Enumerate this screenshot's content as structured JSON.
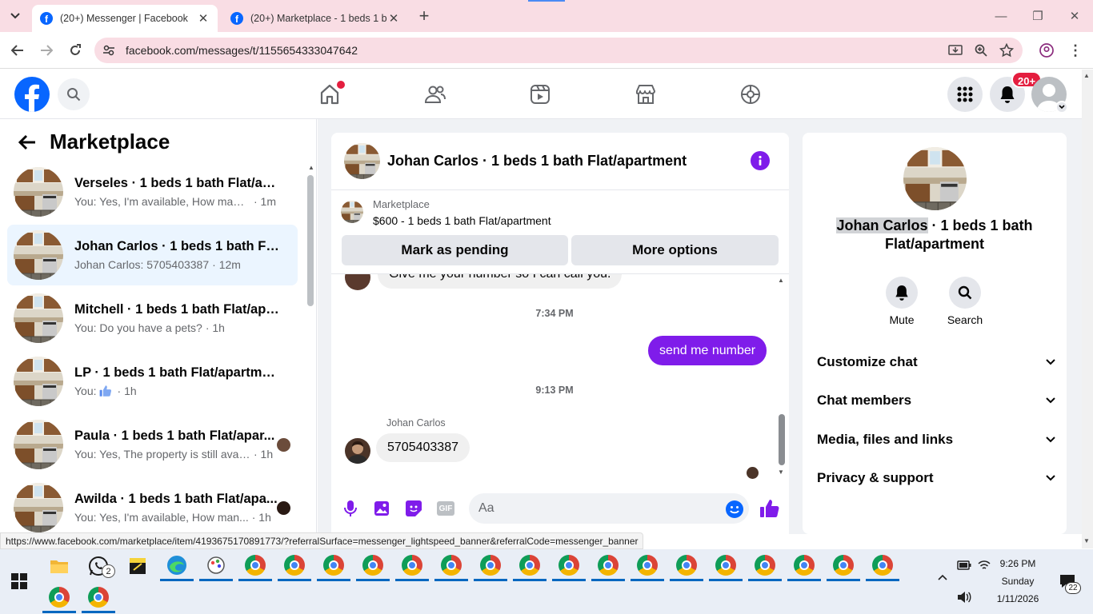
{
  "browser": {
    "tabs": [
      {
        "title": "(20+) Messenger | Facebook",
        "active": true
      },
      {
        "title": "(20+) Marketplace - 1 beds 1 b...",
        "active": false
      }
    ],
    "url": "facebook.com/messages/t/1155654333047642",
    "status_url": "https://www.facebook.com/marketplace/item/4193675170891773/?referralSurface=messenger_lightspeed_banner&referralCode=messenger_banner"
  },
  "fb": {
    "notif_badge": "20+"
  },
  "sidebar": {
    "title": "Marketplace",
    "conversations": [
      {
        "name": "Verseles · 1 beds 1 bath Flat/apar...",
        "preview": "You: Yes, I'm available, How many ...",
        "time": "· 1m",
        "selected": false
      },
      {
        "name": "Johan Carlos · 1 beds 1 bath Flat/...",
        "preview": "Johan Carlos: 5705403387",
        "time": "· 12m",
        "selected": true
      },
      {
        "name": "Mitchell · 1 beds 1 bath Flat/apar...",
        "preview": "You: Do you have a pets?",
        "time": "· 1h",
        "selected": false
      },
      {
        "name": "LP · 1 beds 1 bath Flat/apartment",
        "preview": "You:",
        "time": "· 1h",
        "selected": false
      },
      {
        "name": "Paula · 1 beds 1 bath Flat/apar...",
        "preview": "You: Yes, The property is still avai...",
        "time": "· 1h",
        "selected": false
      },
      {
        "name": "Awilda · 1 beds 1 bath Flat/apa...",
        "preview": "You: Yes, I'm available, How man...",
        "time": "· 1h",
        "selected": false
      }
    ]
  },
  "chat": {
    "header_title": "Johan Carlos · 1 beds 1 bath Flat/apartment",
    "listing_source": "Marketplace",
    "listing_title": "$600 - 1 beds 1 bath Flat/apartment",
    "mark_pending": "Mark as pending",
    "more_options": "More options",
    "partial_message": "Give me your number so I can call you.",
    "time1": "7:34 PM",
    "sent_message": "send me number",
    "time2": "9:13 PM",
    "sender_name": "Johan Carlos",
    "received_message": "5705403387",
    "composer_placeholder": "Aa"
  },
  "details": {
    "name_highlight": "Johan Carlos",
    "name_rest": " · 1 beds 1 bath Flat/apartment",
    "mute": "Mute",
    "search": "Search",
    "sections": [
      "Customize chat",
      "Chat members",
      "Media, files and links",
      "Privacy & support"
    ]
  },
  "taskbar": {
    "whatsapp_badge": "2",
    "time": "9:26 PM",
    "day": "Sunday",
    "date": "1/11/2026",
    "notif_count": "22"
  },
  "colors": {
    "fb_blue": "#0866ff",
    "messenger_purple": "#7f1cea",
    "tab_pink": "#f9dde4",
    "selected_row": "#ebf5ff"
  }
}
